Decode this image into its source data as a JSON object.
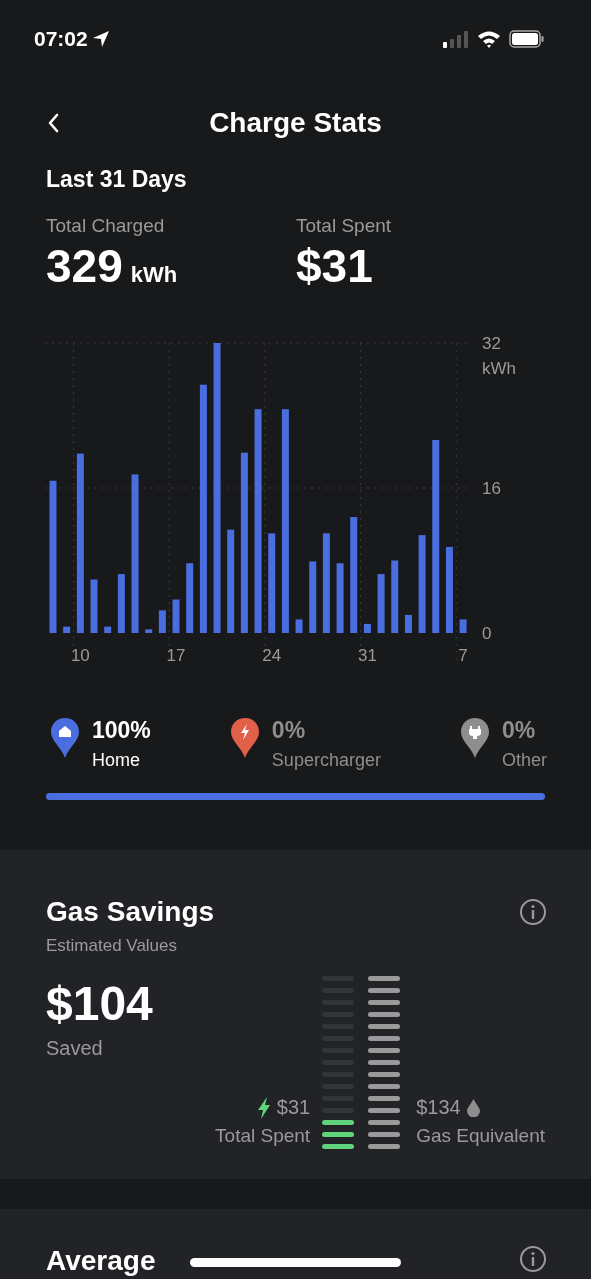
{
  "status_bar": {
    "time": "07:02"
  },
  "header": {
    "title": "Charge Stats"
  },
  "period": "Last 31 Days",
  "totals": [
    {
      "label": "Total Charged",
      "value": "329",
      "unit": "kWh"
    },
    {
      "label": "Total Spent",
      "value": "$31"
    }
  ],
  "chart_data": {
    "type": "bar",
    "ylabel": "kWh",
    "ylim": [
      0,
      32
    ],
    "yticks": [
      0,
      16,
      32
    ],
    "grid": true,
    "categories": [
      null,
      null,
      "10",
      null,
      null,
      null,
      null,
      null,
      null,
      "17",
      null,
      null,
      null,
      null,
      null,
      null,
      "24",
      null,
      null,
      null,
      null,
      null,
      null,
      "31",
      null,
      null,
      null,
      null,
      null,
      null,
      "7"
    ],
    "series": [
      {
        "color": "#4a6ee0",
        "values": [
          16.8,
          0.7,
          19.8,
          5.9,
          0.7,
          6.5,
          17.5,
          0.4,
          2.5,
          3.7,
          7.7,
          27.4,
          32,
          11.4,
          19.9,
          24.7,
          11,
          24.7,
          1.5,
          7.9,
          11,
          7.7,
          12.8,
          1,
          6.5,
          8,
          2,
          10.8,
          21.3,
          9.5,
          1.5
        ]
      }
    ]
  },
  "sources": [
    {
      "kind": "home",
      "percent": "100%",
      "label": "Home",
      "selected": true,
      "color": "#4a6ee0"
    },
    {
      "kind": "supercharger",
      "percent": "0%",
      "label": "Supercharger",
      "selected": false,
      "color": "#e0604a"
    },
    {
      "kind": "other",
      "percent": "0%",
      "label": "Other",
      "selected": false,
      "color": "#8e8e8e"
    }
  ],
  "source_share": {
    "level": 1
  },
  "gas_savings": {
    "title": "Gas Savings",
    "subtitle": "Estimated Values",
    "amount": "$104",
    "amount_label": "Saved",
    "spent": {
      "value": "$31",
      "label": "Total Spent",
      "level": 0.2
    },
    "gas": {
      "value": "$134",
      "label": "Gas Equivalent",
      "level": 1
    }
  },
  "next_card": {
    "title": "Average"
  }
}
